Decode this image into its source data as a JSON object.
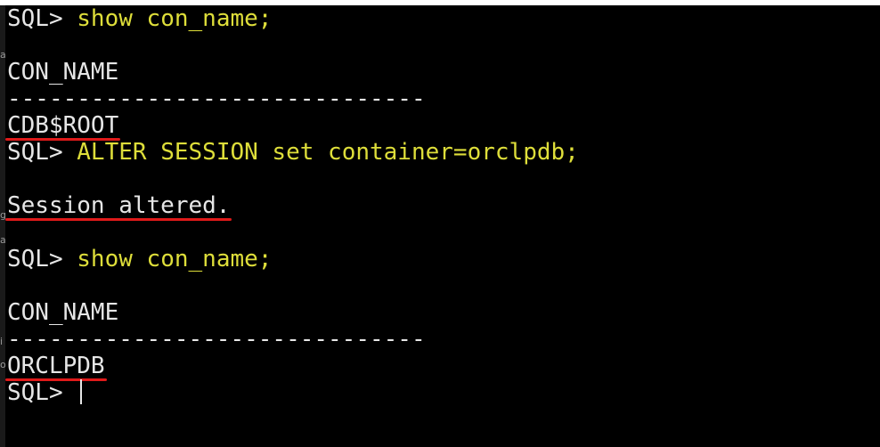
{
  "terminal": {
    "lines": [
      {
        "prompt": "SQL> ",
        "command": "show con_name;"
      },
      {
        "text": ""
      },
      {
        "text": "CON_NAME"
      },
      {
        "text": "------------------------------"
      },
      {
        "text": "CDB$ROOT"
      },
      {
        "prompt": "SQL> ",
        "command": "ALTER SESSION set container=orclpdb;"
      },
      {
        "text": ""
      },
      {
        "text": "Session altered."
      },
      {
        "text": ""
      },
      {
        "prompt": "SQL> ",
        "command": "show con_name;"
      },
      {
        "text": ""
      },
      {
        "text": "CON_NAME"
      },
      {
        "text": "------------------------------"
      },
      {
        "text": "ORCLPDB"
      },
      {
        "prompt": "SQL> ",
        "command": ""
      }
    ]
  },
  "gutter": {
    "frag_1": "a",
    "frag_2": "g",
    "frag_3": "a",
    "frag_4": "i",
    "frag_5": "o"
  },
  "colors": {
    "background": "#000000",
    "text": "#e6e6e6",
    "command": "#dede3a",
    "highlight_underline": "#e01a1a"
  }
}
